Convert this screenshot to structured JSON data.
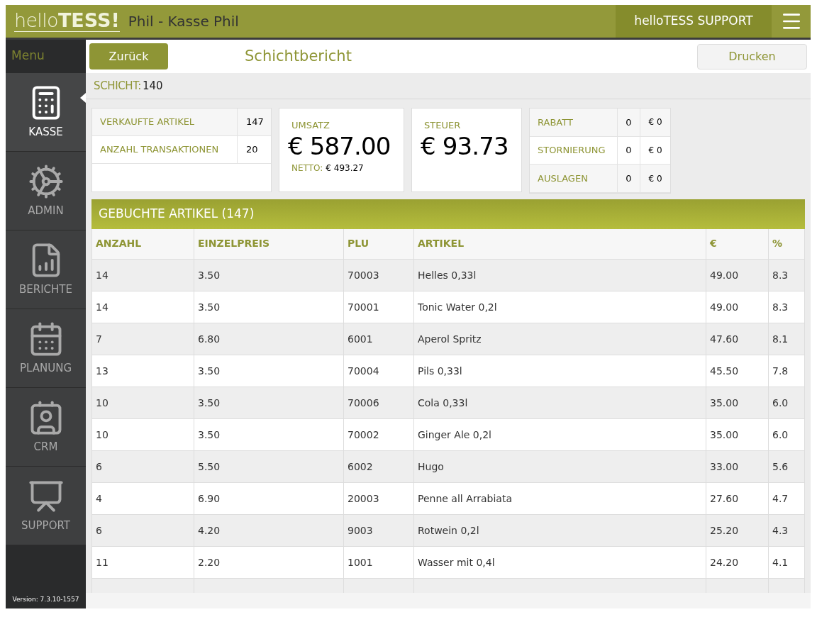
{
  "header": {
    "logo_light": "hello",
    "logo_bold": "TESS!",
    "title": "Phil - Kasse Phil",
    "support": "helloTESS SUPPORT"
  },
  "sidebar": {
    "menu_label": "Menu",
    "version": "Version: 7.3.10-1557",
    "items": [
      {
        "kind": "register",
        "label": "KASSE",
        "selected": true
      },
      {
        "kind": "gears",
        "label": "ADMIN",
        "selected": false
      },
      {
        "kind": "report",
        "label": "BERICHTE",
        "selected": false
      },
      {
        "kind": "calendar",
        "label": "PLANUNG",
        "selected": false
      },
      {
        "kind": "contact",
        "label": "CRM",
        "selected": false
      },
      {
        "kind": "dashboard",
        "label": "SUPPORT",
        "selected": false
      }
    ]
  },
  "toolbar": {
    "back": "Zurück",
    "title": "Schichtbericht",
    "print": "Drucken"
  },
  "shift": {
    "label": "SCHICHT:",
    "value": "140"
  },
  "counts": [
    {
      "label": "VERKAUFTE ARTIKEL",
      "value": "147"
    },
    {
      "label": "ANZAHL TRANSAKTIONEN",
      "value": "20"
    }
  ],
  "revenue": {
    "label": "UMSATZ",
    "value": "€ 587.00",
    "net_label": "NETTO:",
    "net_value": "€ 493.27"
  },
  "tax": {
    "label": "STEUER",
    "value": "€ 93.73"
  },
  "adjustments": [
    {
      "label": "RABATT",
      "count": "0",
      "amount": "€ 0"
    },
    {
      "label": "STORNIERUNG",
      "count": "0",
      "amount": "€ 0"
    },
    {
      "label": "AUSLAGEN",
      "count": "0",
      "amount": "€ 0"
    }
  ],
  "table": {
    "title": "GEBUCHTE ARTIKEL (147)",
    "columns": [
      "ANZAHL",
      "EINZELPREIS",
      "PLU",
      "ARTIKEL",
      "€",
      "%"
    ],
    "rows": [
      [
        "14",
        "3.50",
        "70003",
        "Helles 0,33l",
        "49.00",
        "8.3"
      ],
      [
        "14",
        "3.50",
        "70001",
        "Tonic Water 0,2l",
        "49.00",
        "8.3"
      ],
      [
        "7",
        "6.80",
        "6001",
        "Aperol Spritz",
        "47.60",
        "8.1"
      ],
      [
        "13",
        "3.50",
        "70004",
        "Pils 0,33l",
        "45.50",
        "7.8"
      ],
      [
        "10",
        "3.50",
        "70006",
        "Cola 0,33l",
        "35.00",
        "6.0"
      ],
      [
        "10",
        "3.50",
        "70002",
        "Ginger Ale 0,2l",
        "35.00",
        "6.0"
      ],
      [
        "6",
        "5.50",
        "6002",
        "Hugo",
        "33.00",
        "5.6"
      ],
      [
        "4",
        "6.90",
        "20003",
        "Penne all Arrabiata",
        "27.60",
        "4.7"
      ],
      [
        "6",
        "4.20",
        "9003",
        "Rotwein 0,2l",
        "25.20",
        "4.3"
      ],
      [
        "11",
        "2.20",
        "1001",
        "Wasser mit 0,4l",
        "24.20",
        "4.1"
      ]
    ]
  }
}
